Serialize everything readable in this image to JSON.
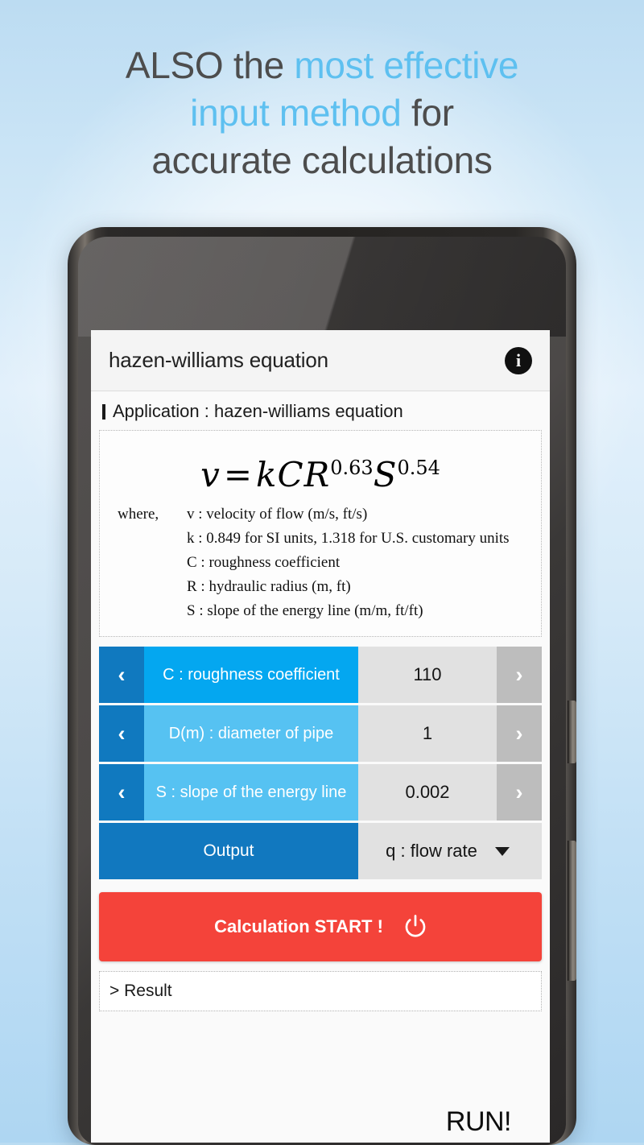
{
  "promo": {
    "headline_part1": "ALSO the ",
    "headline_accent1": "most effective",
    "headline_part2": "",
    "headline_accent2": "input method",
    "headline_part3": " for",
    "headline_part4": "accurate calculations",
    "accent_color": "#5ec0f0",
    "text_color": "#4d4d4d"
  },
  "app": {
    "title": "hazen-williams equation",
    "info_icon": "info-icon",
    "info_glyph": "i",
    "application_line": "Application : hazen-williams equation"
  },
  "formula": {
    "equation_lhs": "v",
    "equation_eq": "=",
    "equation_k": "k",
    "equation_C": "C",
    "equation_R": "R",
    "equation_R_exp": "0.63",
    "equation_S": "S",
    "equation_S_exp": "0.54",
    "where_label": "where,",
    "definitions": [
      "v : velocity of flow  (m/s,  ft/s)",
      "k : 0.849  for  SI  units,  1.318  for  U.S.  customary  units",
      "C : roughness  coefficient",
      "R : hydraulic  radius  (m,  ft)",
      "S : slope  of  the  energy  line  (m/m,  ft/ft)"
    ]
  },
  "inputs": {
    "rows": [
      {
        "label": "C : roughness coefficient",
        "value": "110",
        "left_arrow": "‹",
        "right_arrow": "›",
        "tone": "bright"
      },
      {
        "label": "D(m) : diameter of pipe",
        "value": "1",
        "left_arrow": "‹",
        "right_arrow": "›",
        "tone": "light"
      },
      {
        "label": "S : slope of the energy line",
        "value": "0.002",
        "left_arrow": "‹",
        "right_arrow": "›",
        "tone": "light"
      }
    ],
    "output": {
      "label": "Output",
      "selected": "q : flow rate"
    },
    "colors": {
      "arrow_left_bg": "#1079bf",
      "label_bright_bg": "#04a7f0",
      "label_light_bg": "#56c2f2",
      "value_bg": "#e1e1e1",
      "arrow_right_bg": "#bdbdbd",
      "output_bg": "#1178bf"
    }
  },
  "actions": {
    "start_label": "Calculation START !",
    "start_color": "#f4433a",
    "power_icon": "power-icon"
  },
  "result": {
    "placeholder": "> Result"
  },
  "overlay": {
    "run_label": "RUN!"
  }
}
